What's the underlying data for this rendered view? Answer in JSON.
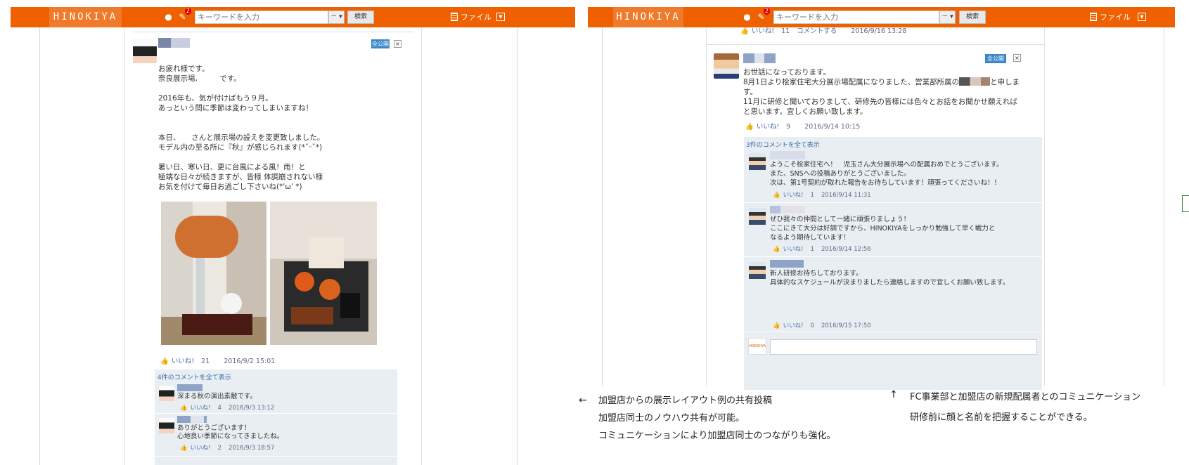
{
  "topbar": {
    "logo": "HINOKIYA",
    "notif_badge": "2",
    "search_placeholder": "キーワードを入力",
    "scope_label": "－ ▾",
    "search_button": "検索",
    "file_menu": "ファイル",
    "caret": "▼"
  },
  "left_post": {
    "public_label": "全公開",
    "close_label": "×",
    "body": "お疲れ様です。\n奈良展示場,　　　です。\n\n2016年も、気が付けばもう９月。\nあっという間に季節は変わってしまいますね！\n\n\n本日、　　さんと展示場の設えを変更致しました。\nモデル内の至る所に『秋』が感じられます(*ˇᵕˇ*)\n\n暑い日、寒い日、更に台風による風！雨！と\n極端な日々が続きますが、皆様 体調崩されない様\nお気を付けて毎日お過ごし下さいね(*'ω' *)",
    "like_label": "いいね!",
    "like_count": "21",
    "timestamp": "2016/9/2 15:01",
    "show_comments": "4件のコメントを全て表示",
    "comments": [
      {
        "text": "深まる秋の演出素敵です。",
        "like_label": "いいね!",
        "likes": "4",
        "time": "2016/9/3 13:12"
      },
      {
        "text": "ありがとうございます！\n心地良い季節になってきましたね。",
        "like_label": "いいね!",
        "likes": "2",
        "time": "2016/9/3 18:57"
      }
    ]
  },
  "right_post": {
    "prev_meta": {
      "like_label": "いいね!",
      "likes": "11",
      "comment_label": "コメントする",
      "time": "2016/9/16 13:28"
    },
    "public_label": "全公開",
    "close_label": "×",
    "body_lines": [
      "お世話になっております。",
      "8月1日より桧家住宅大分展示場配属になりました、営業部所属の",
      "と申しま",
      "す。",
      "11月に研修と聞いておりまして、研修先の皆様には色々とお話をお聞かせ願えれば",
      "と思います。宜しくお願い致します。"
    ],
    "like_label": "いいね!",
    "like_count": "9",
    "timestamp": "2016/9/14 10:15",
    "show_comments": "3件のコメントを全て表示",
    "comments": [
      {
        "text": "ようこそ桧家住宅へ！　児玉さん大分展示場への配属おめでとうございます。\nまた、SNSへの投稿ありがとうございました。\n次は、第1号契約が取れた報告をお待ちしています！頑張ってくださいね！！",
        "like_label": "いいね!",
        "likes": "1",
        "time": "2016/9/14 11:31"
      },
      {
        "text": "ぜひ我々の仲間として一緒に頑張りましょう！\nここにきて大分は好調ですから、HINOKIYAをしっかり勉強して早く戦力と\nなるよう期待しています！",
        "like_label": "いいね!",
        "likes": "1",
        "time": "2016/9/14 12:56"
      },
      {
        "text": "新人研修お待ちしております。\n具体的なスケジュールが決まりましたら連絡しますので宜しくお願い致します。",
        "like_label": "いいね!",
        "likes": "0",
        "time": "2016/9/15 17:50"
      }
    ],
    "mini_logo": "HINOKIYA"
  },
  "notes": {
    "left_arrow": "←",
    "left_text": "加盟店からの展示レイアウト例の共有投稿\n加盟店同士のノウハウ共有が可能。\nコミュニケーションにより加盟店同士のつながりも強化。",
    "up_arrow": "↑",
    "right_text": "FC事業部と加盟店の新規配属者とのコミュニケーション\n研修前に顔と名前を把握することができる。"
  },
  "colors": {
    "header": "#ee6000",
    "logo_bg": "#f07a2a",
    "public_badge": "#3b88c9",
    "comment_bg": "#e9eef3"
  }
}
